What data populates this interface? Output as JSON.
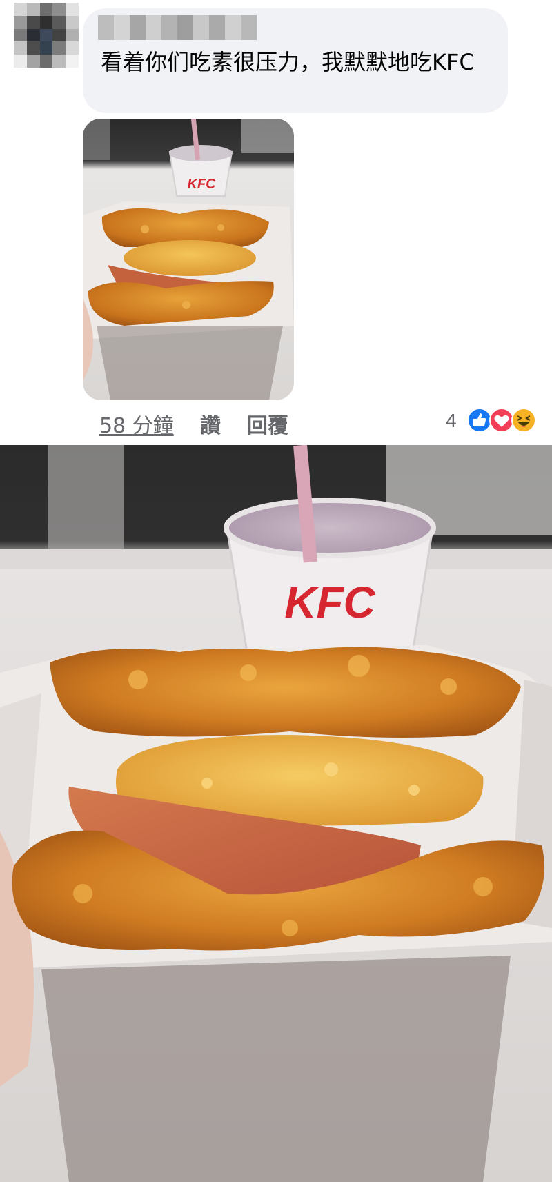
{
  "comment": {
    "author_name": "",
    "text": "看着你们吃素很压力，我默默地吃KFC",
    "photo_cup_logo": "KFC"
  },
  "actions": {
    "timestamp": "58 分鐘",
    "like_label": "讚",
    "reply_label": "回覆"
  },
  "reactions": {
    "count": "4",
    "icons": [
      "like-icon",
      "love-icon",
      "haha-icon"
    ]
  },
  "large_photo": {
    "cup_logo": "KFC"
  },
  "colors": {
    "bubble_bg": "#f0f2f5",
    "meta_text": "#65676b",
    "like_blue": "#1877f2",
    "love_red": "#f33e58",
    "haha_yellow": "#f7b125",
    "kfc_red": "#d6262f"
  }
}
